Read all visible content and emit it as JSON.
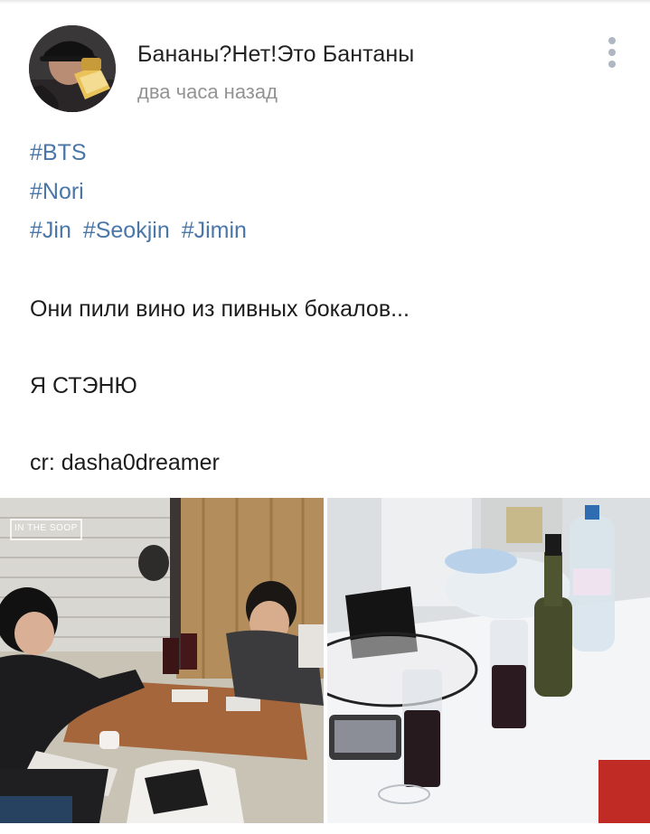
{
  "post": {
    "author": "Бананы?Нет!Это Бантаны",
    "time": "два часа назад",
    "menu_icon": "more-vertical-icon",
    "hashtags": [
      [
        "#BTS"
      ],
      [
        "#Nori"
      ],
      [
        "#Jin",
        "#Seokjin",
        "#Jimin"
      ]
    ],
    "lines": [
      "Они пили вино из пивных бокалов...",
      "Я СТЭНЮ",
      "cr: dasha0dreamer"
    ]
  },
  "photos": {
    "left_watermark": "IN THE SOOP"
  },
  "colors": {
    "link": "#4a76a8",
    "text": "#1c1c1c",
    "meta": "#939393",
    "menu": "#aeb7c2"
  }
}
